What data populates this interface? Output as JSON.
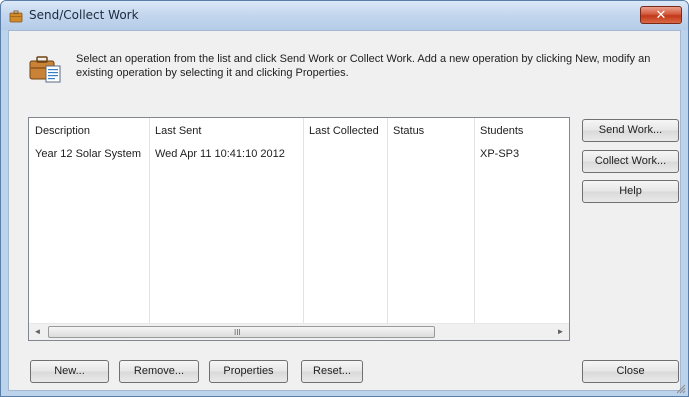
{
  "window": {
    "title": "Send/Collect Work",
    "close_glyph": "✕"
  },
  "instructions": "Select an operation from the list and click Send Work or Collect Work. Add a new operation by clicking New, modify an existing operation by selecting it and clicking Properties.",
  "list": {
    "columns": [
      "Description",
      "Last Sent",
      "Last Collected",
      "Status",
      "Students"
    ],
    "rows": [
      [
        "Year 12 Solar System",
        "Wed Apr 11 10:41:10 2012",
        "",
        "",
        "XP-SP3"
      ]
    ],
    "scroll_grip": "III",
    "scroll_left": "◄",
    "scroll_right": "►"
  },
  "side_buttons": {
    "send": "Send Work...",
    "collect": "Collect Work...",
    "help": "Help"
  },
  "bottom_buttons": {
    "new": "New...",
    "remove": "Remove...",
    "properties": "Properties",
    "reset": "Reset...",
    "close": "Close"
  },
  "icons": {
    "title": "briefcase-icon",
    "header": "briefcase-document-icon"
  }
}
